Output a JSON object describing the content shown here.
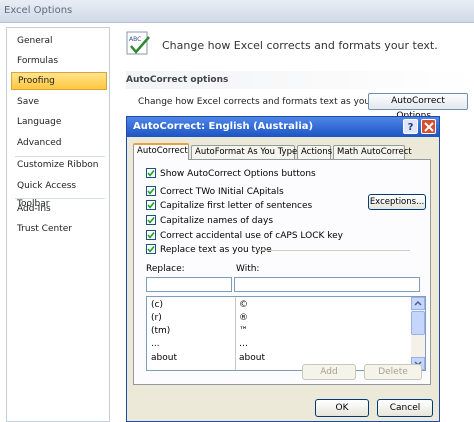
{
  "window": {
    "title": "Excel Options"
  },
  "sidebar": {
    "items": [
      {
        "label": "General"
      },
      {
        "label": "Formulas"
      },
      {
        "label": "Proofing"
      },
      {
        "label": "Save"
      },
      {
        "label": "Language"
      },
      {
        "label": "Advanced"
      },
      {
        "label": "Customize Ribbon"
      },
      {
        "label": "Quick Access Toolbar"
      },
      {
        "label": "Add-Ins"
      },
      {
        "label": "Trust Center"
      }
    ],
    "selected": "Proofing"
  },
  "main": {
    "header": "Change how Excel corrects and formats your text.",
    "icon": "abc-check-icon",
    "section_heading": "AutoCorrect options",
    "autocorrect_description": "Change how Excel corrects and formats text as you type:",
    "autocorrect_button": "AutoCorrect Options..."
  },
  "dialog": {
    "title": "AutoCorrect: English (Australia)",
    "help_label": "?",
    "tabs": [
      {
        "label": "AutoCorrect"
      },
      {
        "label": "AutoFormat As You Type"
      },
      {
        "label": "Actions"
      },
      {
        "label": "Math AutoCorrect"
      }
    ],
    "active_tab": "AutoCorrect",
    "show_buttons": {
      "label": "Show AutoCorrect Options buttons",
      "checked": true
    },
    "options": [
      {
        "label": "Correct TWo INitial CApitals",
        "checked": true
      },
      {
        "label": "Capitalize first letter of sentences",
        "checked": true
      },
      {
        "label": "Capitalize names of days",
        "checked": true
      },
      {
        "label": "Correct accidental use of cAPS LOCK key",
        "checked": true
      },
      {
        "label": "Replace text as you type",
        "checked": true
      }
    ],
    "exceptions_button": "Exceptions...",
    "replace_label": "Replace:",
    "with_label": "With:",
    "replace_value": "",
    "with_value": "",
    "entries": [
      {
        "replace": "(c)",
        "with": "©"
      },
      {
        "replace": "(r)",
        "with": "®"
      },
      {
        "replace": "(tm)",
        "with": "™"
      },
      {
        "replace": "...",
        "with": "…"
      },
      {
        "replace": "about",
        "with": "about"
      }
    ],
    "add_button": "Add",
    "delete_button": "Delete",
    "ok_button": "OK",
    "cancel_button": "Cancel"
  }
}
